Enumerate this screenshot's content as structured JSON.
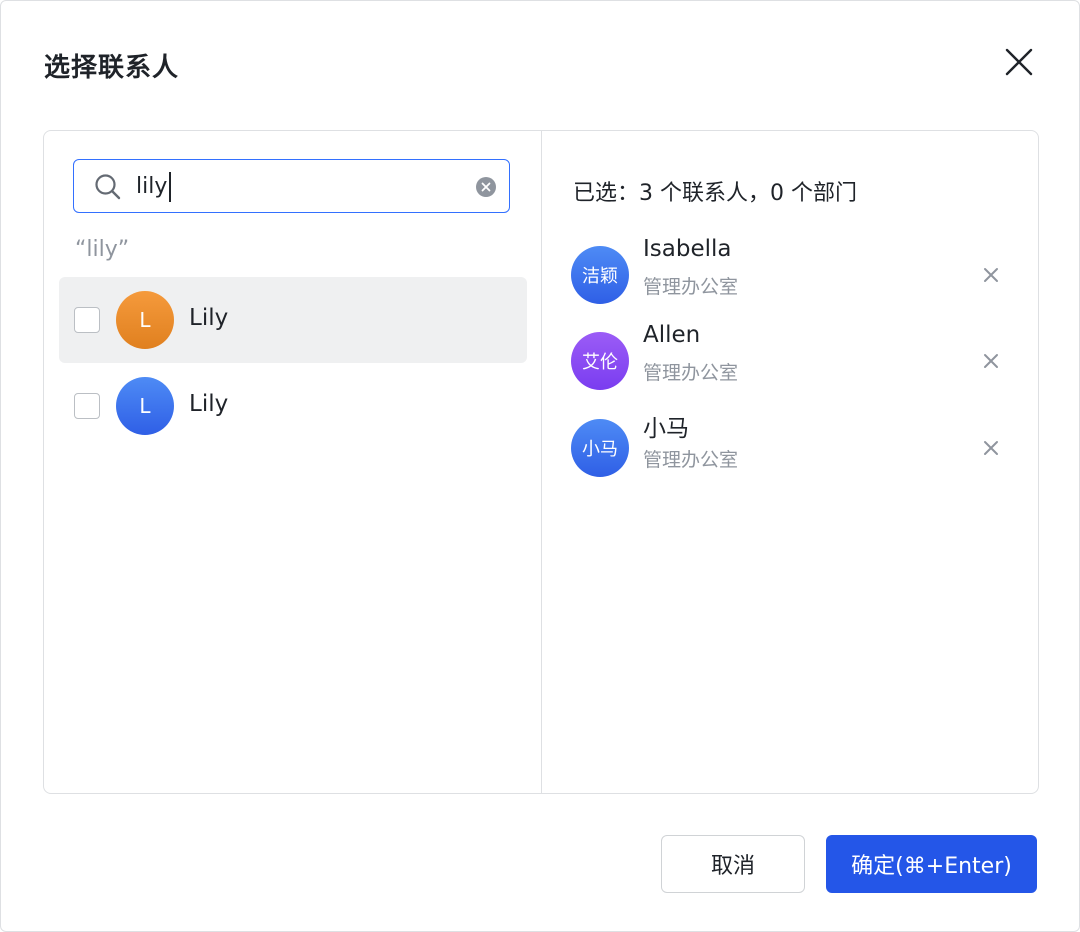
{
  "dialog": {
    "title": "选择联系人",
    "close_icon": "close-icon"
  },
  "search": {
    "value": "lily",
    "search_icon": "search-icon",
    "clear_icon": "clear-circle-icon",
    "query_label": "“lily”"
  },
  "results": [
    {
      "initial": "L",
      "name": "Lily",
      "avatar_color": "#ee8c2a",
      "checked": false
    },
    {
      "initial": "L",
      "name": "Lily",
      "avatar_color": "#3a6ef0",
      "checked": false
    }
  ],
  "selected": {
    "summary": "已选：3 个联系人，0 个部门",
    "items": [
      {
        "avatar_text": "洁颖",
        "name": "Isabella",
        "dept": "管理办公室",
        "avatar_color": "#3a6ef0"
      },
      {
        "avatar_text": "艾伦",
        "name": "Allen",
        "dept": "管理办公室",
        "avatar_color": "#8a4cf3"
      },
      {
        "avatar_text": "小马",
        "name": "小马",
        "dept": "管理办公室",
        "avatar_color": "#3a6ef0"
      }
    ]
  },
  "footer": {
    "cancel_label": "取消",
    "confirm_label": "确定(⌘+Enter)"
  },
  "colors": {
    "primary": "#2456e8",
    "focus_border": "#3370ff",
    "hover_bg": "#eff0f1",
    "muted_text": "#8f959e"
  }
}
